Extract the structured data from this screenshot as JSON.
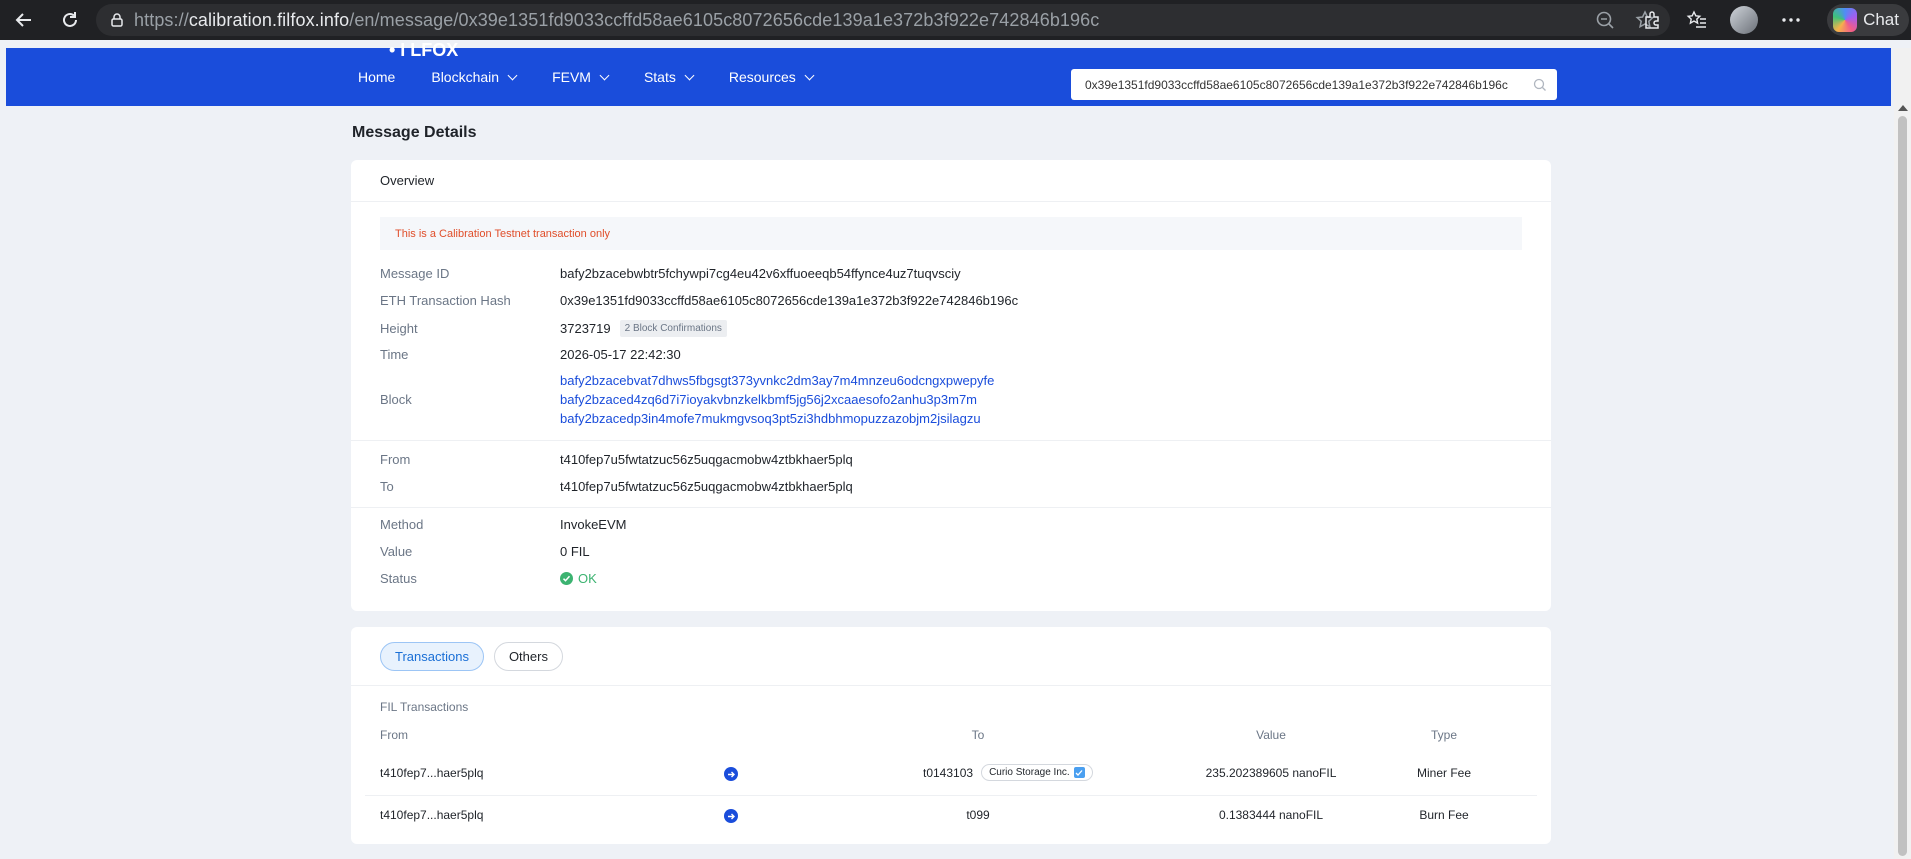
{
  "browser": {
    "url_scheme": "https://",
    "url_host": "calibration.filfox.info",
    "url_path": "/en/message/0x39e1351fd9033ccffd58ae6105c8072656cde139a1e372b3f922e742846b196c",
    "chat_label": "Chat"
  },
  "header": {
    "logo_fragment": "• I LFOX",
    "nav": [
      {
        "label": "Home"
      },
      {
        "label": "Blockchain"
      },
      {
        "label": "FEVM"
      },
      {
        "label": "Stats"
      },
      {
        "label": "Resources"
      }
    ],
    "search_value": "0x39e1351fd9033ccffd58ae6105c8072656cde139a1e372b3f922e742846b196c"
  },
  "page_title": "Message Details",
  "overview": {
    "title": "Overview",
    "notice": "This is a Calibration Testnet transaction only",
    "message_id_label": "Message ID",
    "message_id": "bafy2bzacebwbtr5fchywpi7cg4eu42v6xffuoeeqb54ffynce4uz7tuqvsciy",
    "eth_hash_label": "ETH Transaction Hash",
    "eth_hash": "0x39e1351fd9033ccffd58ae6105c8072656cde139a1e372b3f922e742846b196c",
    "height_label": "Height",
    "height": "3723719",
    "confirmations": "2 Block Confirmations",
    "time_label": "Time",
    "time": "2026-05-17 22:42:30",
    "block_label": "Block",
    "blocks": [
      "bafy2bzacebvat7dhws5fbgsgt373yvnkc2dm3ay7m4mnzeu6odcngxpwepyfe",
      "bafy2bzaced4zq6d7i7ioyakvbnzkelkbmf5jg56j2xcaaesofo2anhu3p3m7m",
      "bafy2bzacedp3in4mofe7mukmgvsoq3pt5zi3hdbhmopuzzazobjm2jsilagzu"
    ],
    "from_label": "From",
    "from": "t410fep7u5fwtatzuc56z5uqgacmobw4ztbkhaer5plq",
    "to_label": "To",
    "to": "t410fep7u5fwtatzuc56z5uqgacmobw4ztbkhaer5plq",
    "method_label": "Method",
    "method": "InvokeEVM",
    "value_label": "Value",
    "value": "0 FIL",
    "status_label": "Status",
    "status": "OK"
  },
  "transactions": {
    "tabs": [
      {
        "label": "Transactions",
        "active": true
      },
      {
        "label": "Others",
        "active": false
      }
    ],
    "section_label": "FIL Transactions",
    "columns": {
      "from": "From",
      "to": "To",
      "value": "Value",
      "type": "Type"
    },
    "rows": [
      {
        "from": "t410fep7...haer5plq",
        "to": "t0143103",
        "to_tag": "Curio Storage Inc.",
        "value": "235.202389605 nanoFIL",
        "type": "Miner Fee"
      },
      {
        "from": "t410fep7...haer5plq",
        "to": "t099",
        "to_tag": "",
        "value": "0.1383444 nanoFIL",
        "type": "Burn Fee"
      }
    ]
  },
  "colors": {
    "brand_blue": "#1a4ddb",
    "ok_green": "#3cb371",
    "notice_red": "#e04e2a"
  }
}
